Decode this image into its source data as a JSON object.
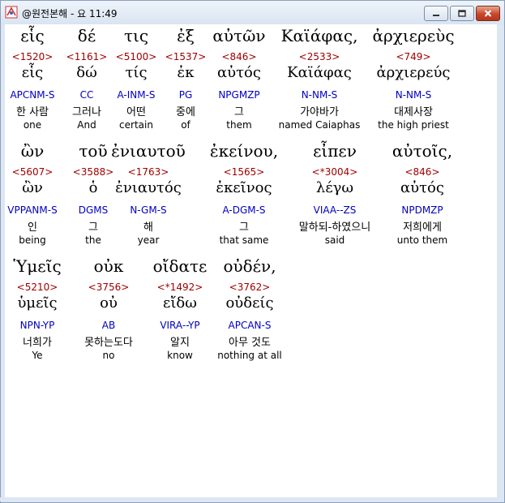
{
  "window": {
    "title": "@원전본해 - 요 11:49"
  },
  "controls": {
    "minimize_icon": "minimize-icon",
    "maximize_icon": "maximize-icon",
    "close_icon": "close-icon"
  },
  "rows": [
    [
      {
        "greek": "εἷς",
        "strong": "<1520>",
        "lemma": "εἷς",
        "parse": "APCNM-S",
        "korean": "한 사람",
        "english": "one"
      },
      {
        "greek": "δέ",
        "strong": "<1161>",
        "lemma": "δώ",
        "parse": "CC",
        "korean": "그러나",
        "english": "And"
      },
      {
        "greek": "τις",
        "strong": "<5100>",
        "lemma": "τίς",
        "parse": "A-INM-S",
        "korean": "어떤",
        "english": "certain"
      },
      {
        "greek": "ἐξ",
        "strong": "<1537>",
        "lemma": "ἐκ",
        "parse": "PG",
        "korean": "중에",
        "english": "of"
      },
      {
        "greek": "αὐτῶν",
        "strong": "<846>",
        "lemma": "αὐτός",
        "parse": "NPGMZP",
        "korean": "그",
        "english": "them"
      },
      {
        "greek": "Καϊάφας,",
        "strong": "<2533>",
        "lemma": "Καϊάφας",
        "parse": "N-NM-S",
        "korean": "가야바가",
        "english": "named Caiaphas"
      },
      {
        "greek": "ἀρχιερεὺς",
        "strong": "<749>",
        "lemma": "ἀρχιερεύς",
        "parse": "N-NM-S",
        "korean": "대제사장",
        "english": "the high priest"
      }
    ],
    [
      {
        "greek": "ὢν",
        "strong": "<5607>",
        "lemma": "ὢν",
        "parse": "VPPANM-S",
        "korean": "인",
        "english": "being"
      },
      {
        "greek": "τοῦ",
        "strong": "<3588>",
        "lemma": "ὁ",
        "parse": "DGMS",
        "korean": "그",
        "english": "the"
      },
      {
        "greek": "ἐνιαυτοῦ",
        "strong": "<1763>",
        "lemma": "ἐνιαυτός",
        "parse": "N-GM-S",
        "korean": "해",
        "english": "year"
      },
      {
        "greek": "ἐκείνου,",
        "strong": "<1565>",
        "lemma": "ἐκεῖνος",
        "parse": "A-DGM-S",
        "korean": "그",
        "english": "that same"
      },
      {
        "greek": "εἶπεν",
        "strong": "<*3004>",
        "lemma": "λέγω",
        "parse": "VIAA--ZS",
        "korean": "말하되-하였으니",
        "english": "said"
      },
      {
        "greek": "αὐτοῖς,",
        "strong": "<846>",
        "lemma": "αὐτός",
        "parse": "NPDMZP",
        "korean": "저희에게",
        "english": "unto them"
      }
    ],
    [
      {
        "greek": "Ὑμεῖς",
        "strong": "<5210>",
        "lemma": "ὑμεῖς",
        "parse": "NPN-YP",
        "korean": "너희가",
        "english": "Ye"
      },
      {
        "greek": "οὐκ",
        "strong": "<3756>",
        "lemma": "οὐ",
        "parse": "AB",
        "korean": "못하는도다",
        "english": "no"
      },
      {
        "greek": "οἴδατε",
        "strong": "<*1492>",
        "lemma": "εἴδω",
        "parse": "VIRA--YP",
        "korean": "알지",
        "english": "know"
      },
      {
        "greek": "οὐδέν,",
        "strong": "<3762>",
        "lemma": "οὐδείς",
        "parse": "APCAN-S",
        "korean": "아무 것도",
        "english": "nothing at all"
      }
    ]
  ]
}
